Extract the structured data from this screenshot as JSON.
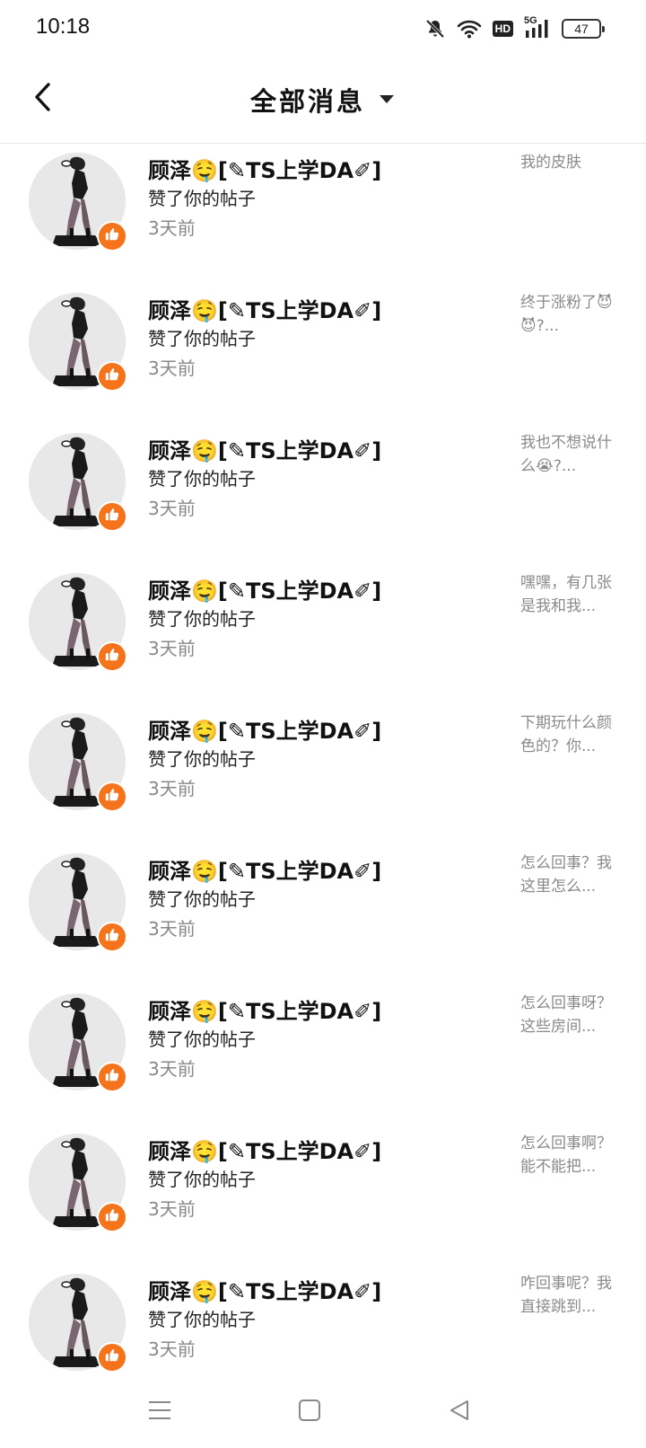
{
  "status_bar": {
    "time": "10:18",
    "network": "5G",
    "hd_label": "HD",
    "battery_level": "47",
    "icons": [
      "mute-bell-icon",
      "wifi-icon",
      "hd-icon",
      "signal-5g-icon",
      "battery-icon"
    ]
  },
  "header": {
    "back_icon": "back-arrow-icon",
    "title": "全部消息",
    "dropdown_icon": "caret-down-icon"
  },
  "colors": {
    "accent": "#f5731b",
    "text_primary": "#111111",
    "text_secondary": "#888888",
    "divider": "#e6e6e6",
    "avatar_bg": "#e8e8e8"
  },
  "messages": [
    {
      "name": "顾泽🤤[✎TS上学DA✐]",
      "action": "赞了你的帖子",
      "time": "3天前",
      "preview": "我的皮肤",
      "badge_icon": "thumbs-up-icon"
    },
    {
      "name": "顾泽🤤[✎TS上学DA✐]",
      "action": "赞了你的帖子",
      "time": "3天前",
      "preview": "终于涨粉了😈😈?...",
      "badge_icon": "thumbs-up-icon"
    },
    {
      "name": "顾泽🤤[✎TS上学DA✐]",
      "action": "赞了你的帖子",
      "time": "3天前",
      "preview": "我也不想说什么😭?...",
      "badge_icon": "thumbs-up-icon"
    },
    {
      "name": "顾泽🤤[✎TS上学DA✐]",
      "action": "赞了你的帖子",
      "time": "3天前",
      "preview": "嘿嘿，有几张是我和我...",
      "badge_icon": "thumbs-up-icon"
    },
    {
      "name": "顾泽🤤[✎TS上学DA✐]",
      "action": "赞了你的帖子",
      "time": "3天前",
      "preview": "下期玩什么颜色的？你...",
      "badge_icon": "thumbs-up-icon"
    },
    {
      "name": "顾泽🤤[✎TS上学DA✐]",
      "action": "赞了你的帖子",
      "time": "3天前",
      "preview": "怎么回事？我这里怎么...",
      "badge_icon": "thumbs-up-icon"
    },
    {
      "name": "顾泽🤤[✎TS上学DA✐]",
      "action": "赞了你的帖子",
      "time": "3天前",
      "preview": "怎么回事呀？这些房间...",
      "badge_icon": "thumbs-up-icon"
    },
    {
      "name": "顾泽🤤[✎TS上学DA✐]",
      "action": "赞了你的帖子",
      "time": "3天前",
      "preview": "怎么回事啊？能不能把...",
      "badge_icon": "thumbs-up-icon"
    },
    {
      "name": "顾泽🤤[✎TS上学DA✐]",
      "action": "赞了你的帖子",
      "time": "3天前",
      "preview": "咋回事呢？我直接跳到...",
      "badge_icon": "thumbs-up-icon"
    }
  ],
  "nav_bar": {
    "icons": [
      "menu-icon",
      "home-square-icon",
      "back-triangle-icon"
    ]
  }
}
